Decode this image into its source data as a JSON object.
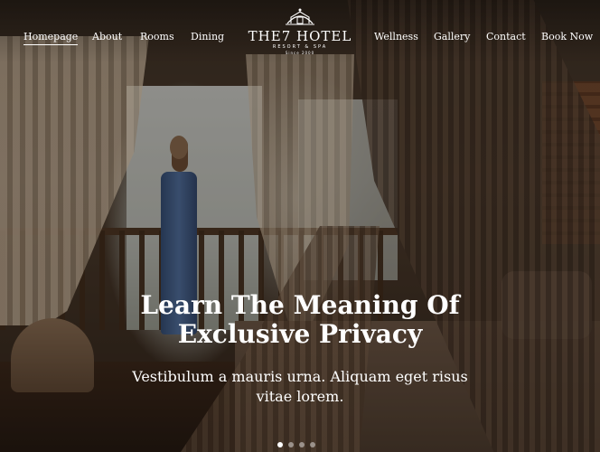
{
  "nav": {
    "left_links": [
      "Homepage",
      "About",
      "Rooms",
      "Dining"
    ],
    "right_links": [
      "Wellness",
      "Gallery",
      "Contact",
      "Book Now"
    ],
    "active": "Homepage"
  },
  "logo": {
    "name": "THE7 HOTEL",
    "subtitle": "RESORT & SPA",
    "since": "Since 2000",
    "icon": "hotel-crest-icon"
  },
  "hero": {
    "headline_line1": "Learn The Meaning Of",
    "headline_line2": "Exclusive Privacy",
    "subtitle_line1": "Vestibulum a mauris urna. Aliquam eget risus",
    "subtitle_line2": "vitae lorem."
  },
  "slider": {
    "total": 4,
    "active_index": 0
  },
  "colors": {
    "text": "#ffffff"
  }
}
